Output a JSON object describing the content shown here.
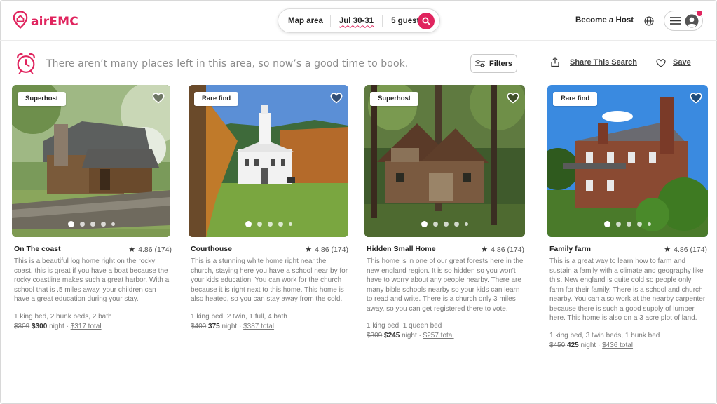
{
  "header": {
    "logo_text": "airEMC",
    "search": {
      "area": "Map area",
      "dates": "Jul 30-31",
      "guests": "5 guests"
    },
    "become_host": "Become a Host"
  },
  "notice": {
    "text": "There aren’t many places left in this area, so now’s a good time to book.",
    "filters_label": "Filters",
    "share_label": "Share This Search",
    "save_label": "Save"
  },
  "listings": [
    {
      "badge": "Superhost",
      "title": "On The coast",
      "rating": "4.86 (174)",
      "description": "This is a beautiful log home right on the rocky coast, this is great if you have a boat because the rocky coastline makes such a great harbor. With a school that is .5 miles away, your children can have a great education during your stay.",
      "beds": "1 king bed, 2 bunk beds, 2 bath",
      "old_price": "$309",
      "new_price": "$300",
      "per": "night",
      "separator": "·",
      "total": "$317 total"
    },
    {
      "badge": "Rare find",
      "title": "Courthouse",
      "rating": "4.86 (174)",
      "description": "This is a stunning white home right near the church, staying here you have a school near by for your kids education. You can work for the church because it is right next to this home. This home is also heated, so you can stay away from the cold.",
      "beds": "1 king bed, 2 twin, 1 full, 4 bath",
      "old_price": "$400",
      "new_price": "375",
      "per": "night",
      "separator": "·",
      "total": "$387  total"
    },
    {
      "badge": "Superhost",
      "title": "Hidden Small Home",
      "rating": "4.86 (174)",
      "description": "This home is in one of our great forests here in the new england region. It is so hidden so you won't have to worry about any people nearby. There are many bible schools nearby so your kids can learn to read and write. There is a church only 3 miles away, so you can get registered there to vote.",
      "beds": "1 king bed, 1 queen bed",
      "old_price": "$309",
      "new_price": "$245",
      "per": "night",
      "separator": "·",
      "total": "$257 total"
    },
    {
      "badge": "Rare find",
      "title": "Family farm",
      "rating": "4.86 (174)",
      "description": "This is a great way to learn how to farm and sustain a family with a climate and geography like this. New england is quite cold so people only farm for their family. There is a school and church nearby. You can also work at the nearby carpenter because there is such a good supply of lumber here. This home is also on a 3 acre plot of land.",
      "beds": "1 king bed, 3 twin beds, 1 bunk bed",
      "old_price": "$450",
      "new_price": "425",
      "per": "night",
      "separator": "·",
      "total": "$436  total"
    }
  ],
  "colors": {
    "brand": "#e0245e",
    "text": "#222222",
    "muted": "#7a7a7a"
  }
}
